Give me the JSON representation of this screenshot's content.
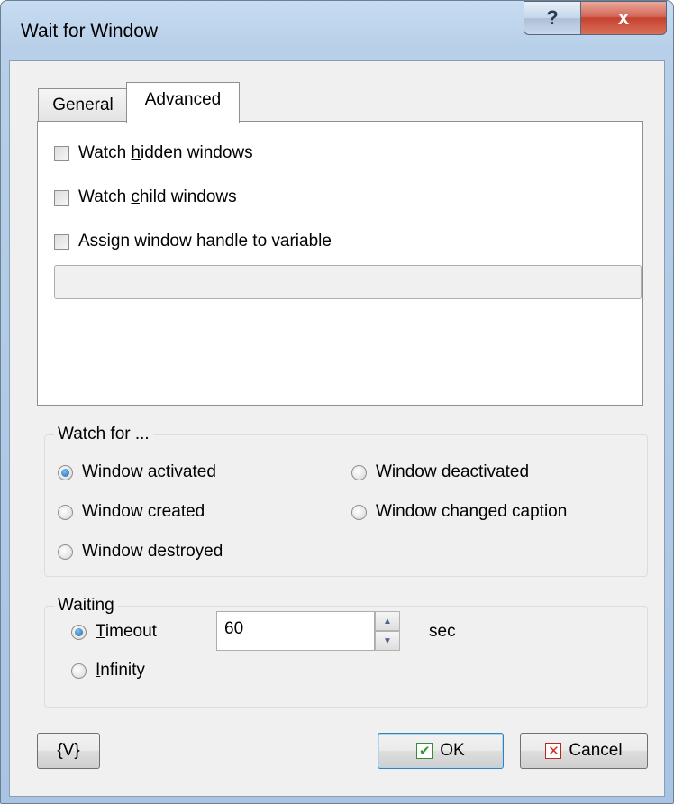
{
  "window": {
    "title": "Wait for Window",
    "help_glyph": "?",
    "close_glyph": "x"
  },
  "tabs": [
    {
      "label": "General",
      "active": false
    },
    {
      "label": "Advanced",
      "active": true
    }
  ],
  "advanced": {
    "watch_hidden": {
      "pre": "Watch ",
      "accel": "h",
      "post": "idden windows",
      "checked": false
    },
    "watch_child": {
      "pre": "Watch ",
      "accel": "c",
      "post": "hild windows",
      "checked": false
    },
    "assign_handle": {
      "label": "Assign window handle to variable",
      "checked": false
    },
    "variable_value": ""
  },
  "watch_for": {
    "label": "Watch for ...",
    "options": [
      {
        "label": "Window activated",
        "checked": true
      },
      {
        "label": "Window deactivated",
        "checked": false
      },
      {
        "label": "Window created",
        "checked": false
      },
      {
        "label": "Window changed caption",
        "checked": false
      },
      {
        "label": "Window destroyed",
        "checked": false
      }
    ]
  },
  "waiting": {
    "label": "Waiting",
    "timeout": {
      "accel": "T",
      "rest": "imeout",
      "checked": true
    },
    "infinity": {
      "accel": "I",
      "rest": "nfinity",
      "checked": false
    },
    "timeout_value": "60",
    "unit": "sec",
    "spin_up": "▲",
    "spin_down": "▼"
  },
  "buttons": {
    "variables": "{V}",
    "ok": "OK",
    "ok_icon": "✔",
    "cancel": "Cancel",
    "cancel_icon": "✕"
  },
  "colors": {
    "ok_icon": "#2f9a2f",
    "cancel_icon": "#d42a1f"
  }
}
